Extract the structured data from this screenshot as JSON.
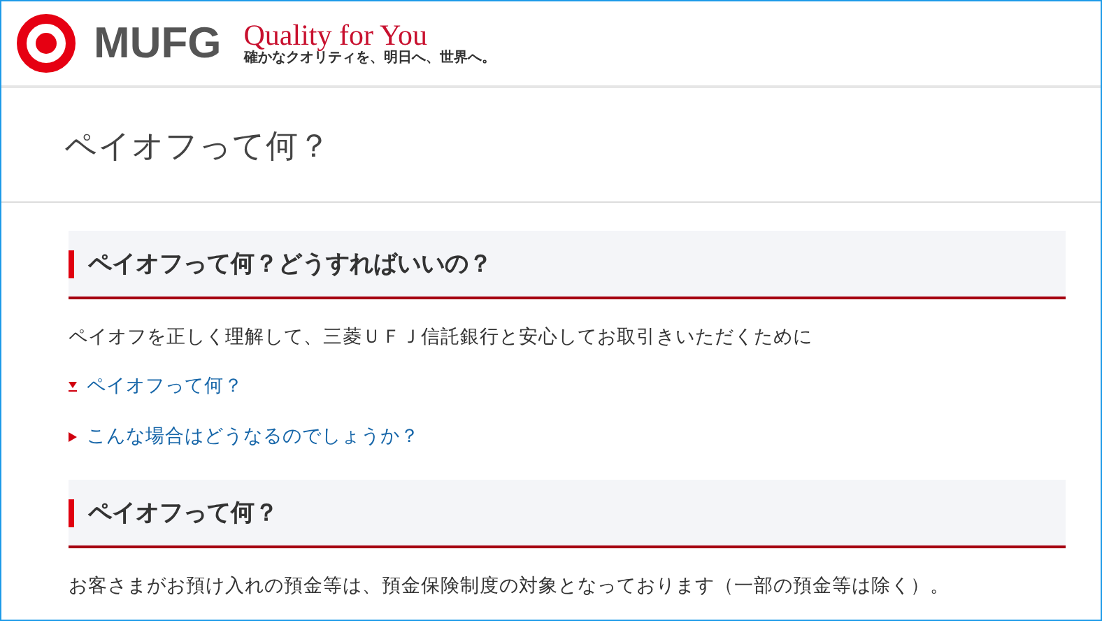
{
  "header": {
    "logo_text": "MUFG",
    "slogan": "Quality for You",
    "tagline": "確かなクオリティを、明日へ、世界へ。"
  },
  "page_title": "ペイオフって何？",
  "sections": [
    {
      "heading": "ペイオフって何？どうすればいいの？",
      "body": "ペイオフを正しく理解して、三菱ＵＦＪ信託銀行と安心してお取引きいただくために",
      "links": [
        {
          "label": "ペイオフって何？",
          "kind": "down"
        },
        {
          "label": "こんな場合はどうなるのでしょうか？",
          "kind": "right"
        }
      ]
    },
    {
      "heading": "ペイオフって何？",
      "body": "お客さまがお預け入れの預金等は、預金保険制度の対象となっております（一部の預金等は除く）。"
    }
  ]
}
